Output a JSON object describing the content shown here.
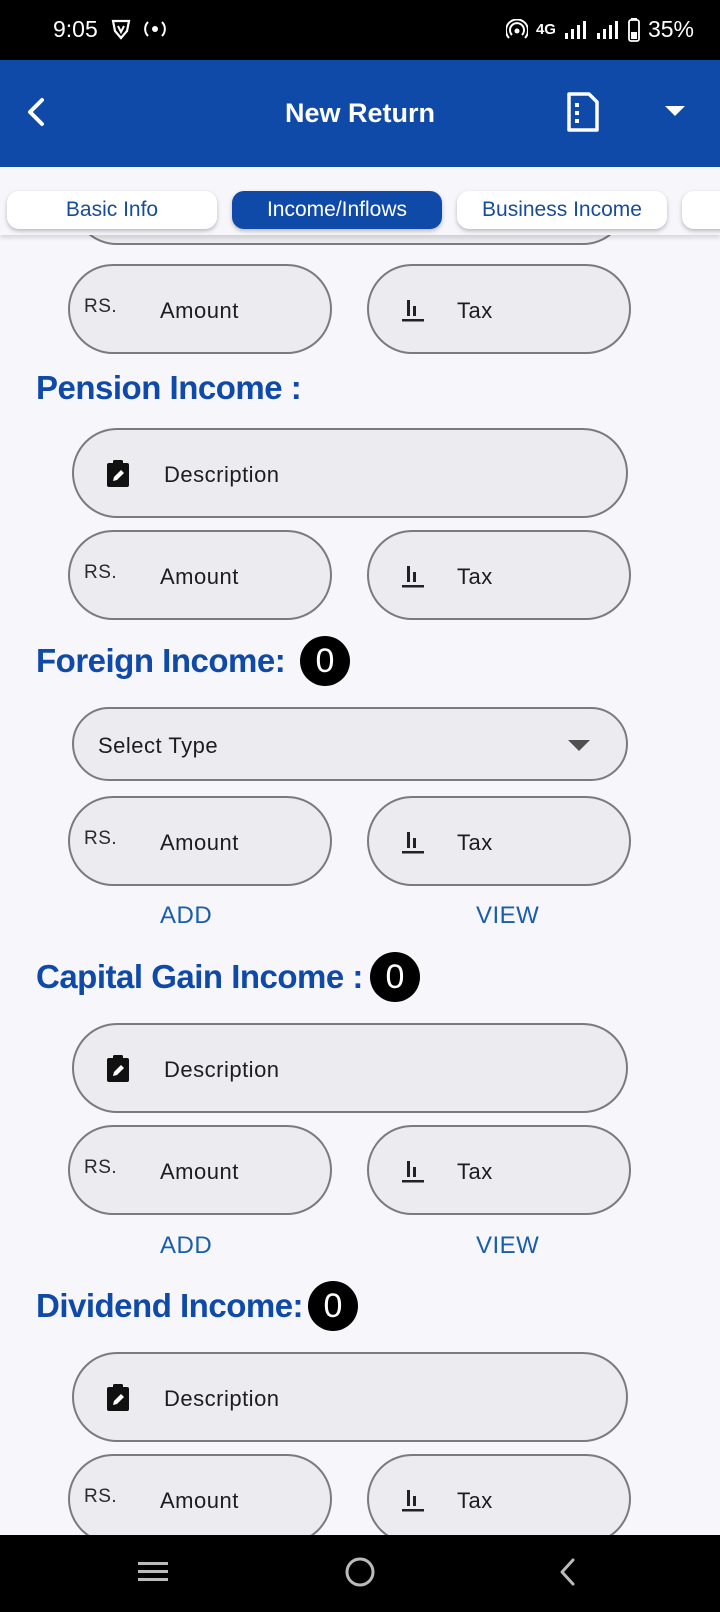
{
  "status_bar": {
    "time": "9:05",
    "network": "4G",
    "battery": "35%",
    "icons": [
      "vpn-shield-icon",
      "hotspot-icon",
      "wifi-calling-icon",
      "signal-icon",
      "battery-icon"
    ]
  },
  "app_bar": {
    "title": "New Return",
    "icons": [
      "back-arrow-icon",
      "document-icon",
      "dropdown-arrow-icon"
    ]
  },
  "tabs": [
    {
      "label": "Basic Info",
      "active": false
    },
    {
      "label": "Income/Inflows",
      "active": true
    },
    {
      "label": "Business Income",
      "active": false
    }
  ],
  "colors": {
    "primary": "#0f4aa8",
    "field_bg": "#ecebf0",
    "field_border": "#7b7b7f",
    "page_bg": "#f6f6fb"
  },
  "field_labels": {
    "currency_prefix": "RS.",
    "amount": "Amount",
    "tax": "Tax",
    "description": "Description",
    "select_type": "Select Type",
    "add": "ADD",
    "view": "VIEW"
  },
  "sections": {
    "pension": {
      "title": "Pension Income :"
    },
    "foreign": {
      "title": "Foreign Income:",
      "count": "0"
    },
    "capital_gain": {
      "title": "Capital Gain Income :",
      "count": "0"
    },
    "dividend": {
      "title": "Dividend Income:",
      "count": "0"
    }
  }
}
